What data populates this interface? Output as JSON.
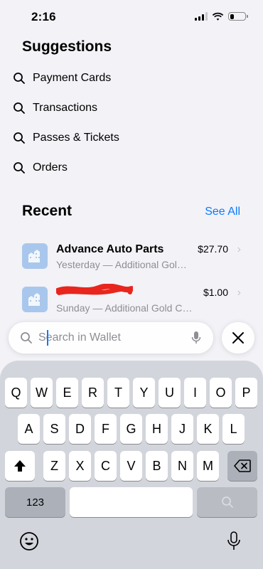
{
  "status": {
    "time": "2:16",
    "battery_level": 0.25,
    "icons": [
      "signal-icon",
      "wifi-icon",
      "battery-icon"
    ]
  },
  "suggestions": {
    "title": "Suggestions",
    "items": [
      {
        "label": "Payment Cards"
      },
      {
        "label": "Transactions"
      },
      {
        "label": "Passes & Tickets"
      },
      {
        "label": "Orders"
      }
    ]
  },
  "recent": {
    "title": "Recent",
    "see_all": "See All",
    "items": [
      {
        "name": "Advance Auto Parts",
        "subtitle": "Yesterday — Additional Gol…",
        "amount": "$27.70"
      },
      {
        "name": "",
        "subtitle": "Sunday — Additional Gold C…",
        "amount": "$1.00"
      }
    ]
  },
  "search": {
    "placeholder": "Search in Wallet",
    "value": ""
  },
  "keyboard": {
    "row1": [
      "Q",
      "W",
      "E",
      "R",
      "T",
      "Y",
      "U",
      "I",
      "O",
      "P"
    ],
    "row2": [
      "A",
      "S",
      "D",
      "F",
      "G",
      "H",
      "J",
      "K",
      "L"
    ],
    "row3": [
      "Z",
      "X",
      "C",
      "V",
      "B",
      "N",
      "M"
    ],
    "numbers_key": "123"
  },
  "colors": {
    "accent": "#0a7aff",
    "card_icon": "#a9c7ec",
    "redaction": "#e8261d"
  }
}
